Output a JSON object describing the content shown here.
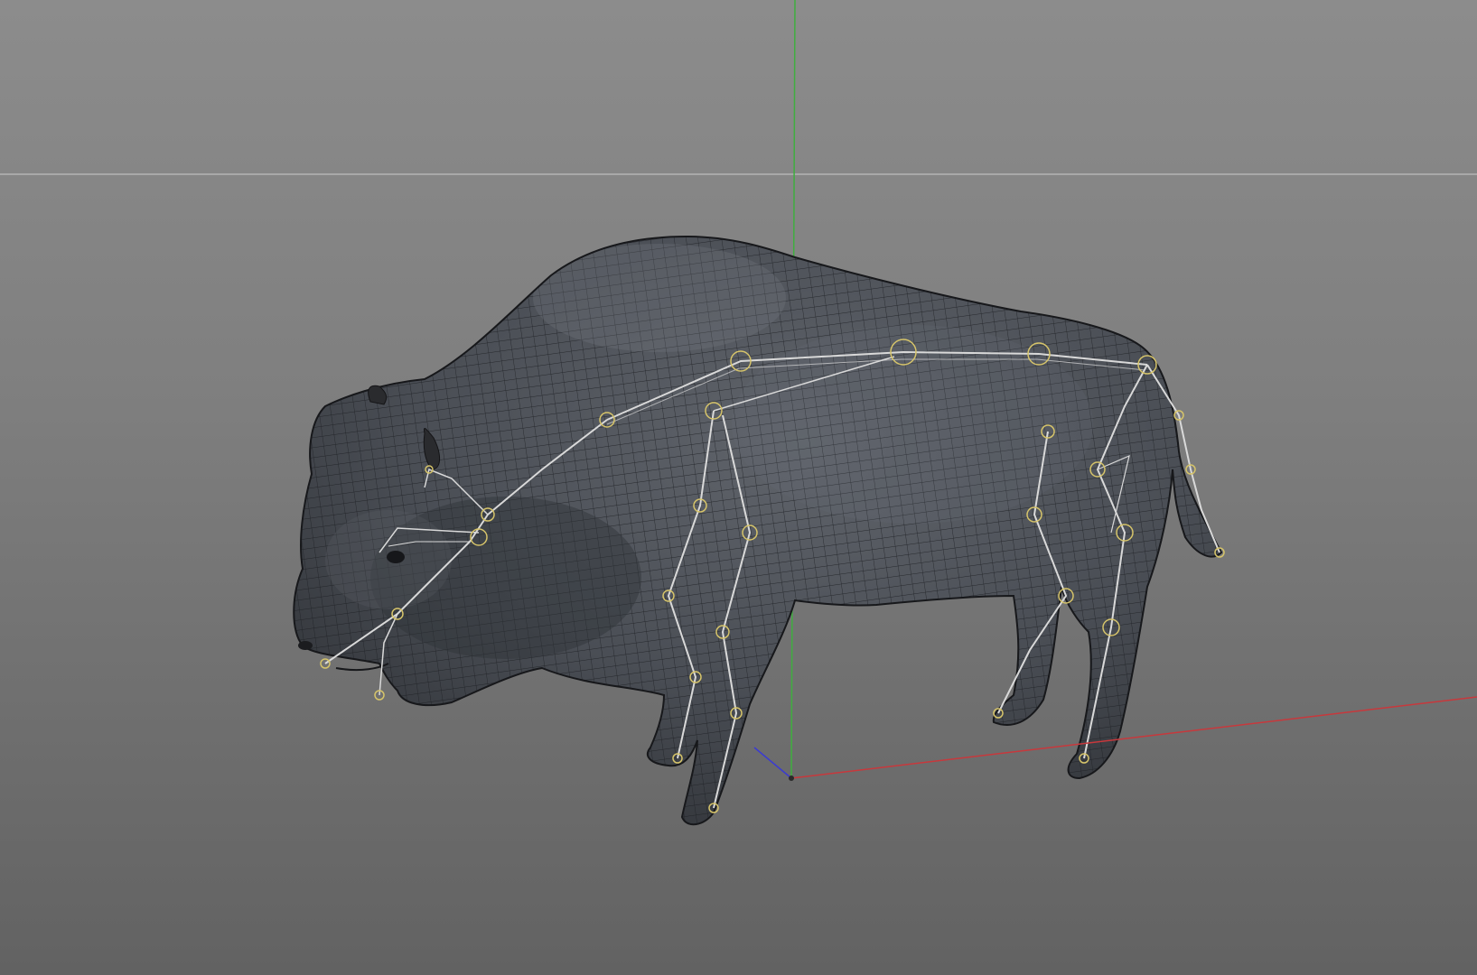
{
  "viewport": {
    "label": "",
    "shading": "wireframe-on-shaded",
    "colors": {
      "background_top": "#8c8c8c",
      "background_bottom": "#626262",
      "horizon_line": "#b4b4b4",
      "axis_x": "#c8383c",
      "axis_y": "#3fae3f",
      "axis_z": "#3b3bd0",
      "mesh_fill": "#4a4e55",
      "mesh_wire": "#1e2024",
      "bone_line": "#d9d9d9",
      "joint": "#d6c46a"
    }
  },
  "model": {
    "object_type": "rigged-bison-mesh",
    "icon": "bison-model-icon"
  },
  "skeleton": {
    "icon": "skeleton-rig-icon"
  }
}
